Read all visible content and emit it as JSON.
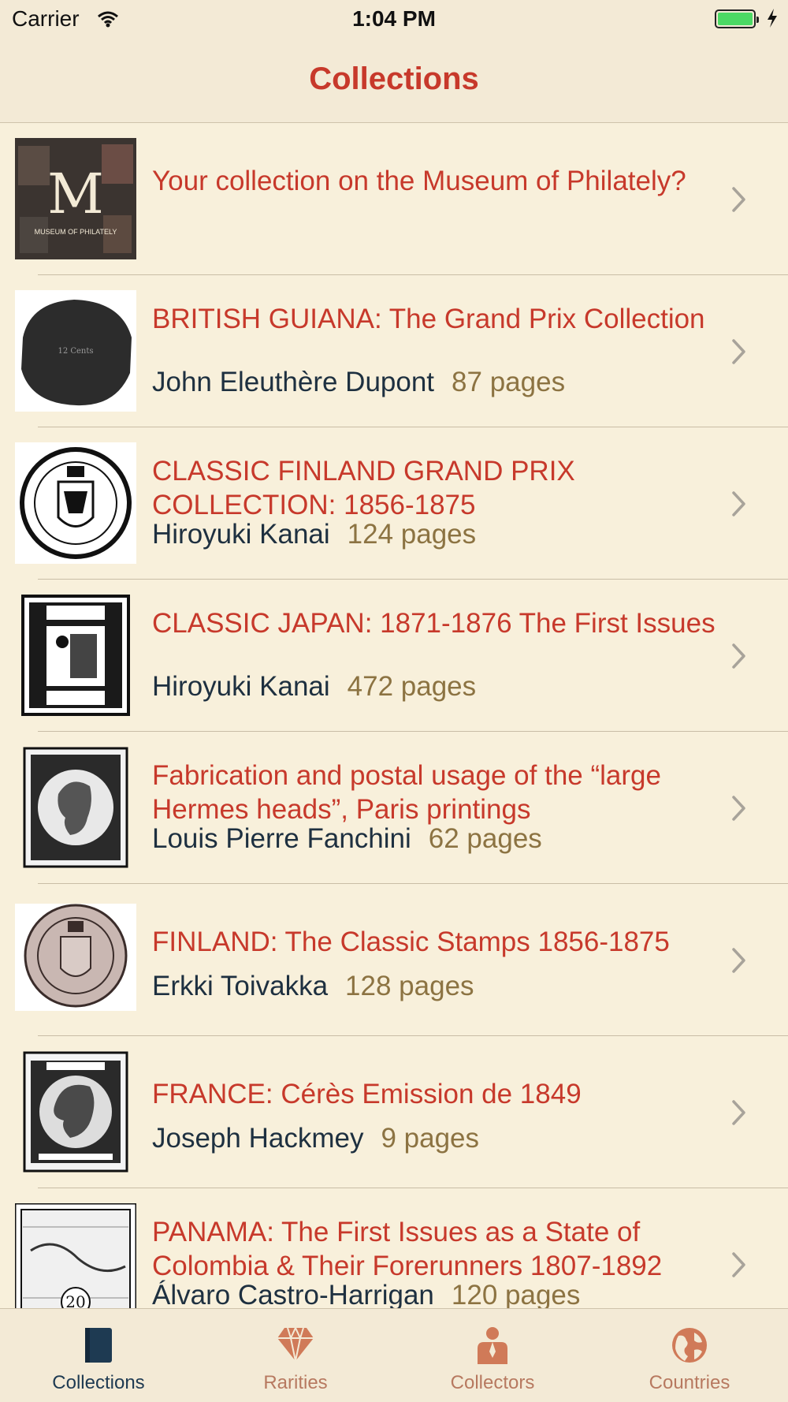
{
  "status_bar": {
    "carrier": "Carrier",
    "time": "1:04 PM",
    "battery_color": "#4cd964"
  },
  "nav": {
    "title": "Collections"
  },
  "promo": {
    "title": "Your collection on the Museum of Philately?",
    "logo_letters": "M",
    "logo_caption": "MUSEUM OF PHILATELY"
  },
  "collections": [
    {
      "title": "BRITISH GUIANA: The Grand Prix Collection",
      "collector": "John Eleuthère Dupont",
      "pages": "87 pages",
      "icon": "british-guiana-stamp-icon"
    },
    {
      "title": "CLASSIC FINLAND GRAND PRIX COLLECTION: 1856-1875",
      "collector": "Hiroyuki Kanai",
      "pages": "124 pages",
      "icon": "finland-stamp-icon"
    },
    {
      "title": "CLASSIC JAPAN: 1871-1876 The First Issues",
      "collector": "Hiroyuki Kanai",
      "pages": "472 pages",
      "icon": "japan-stamp-icon"
    },
    {
      "title": "Fabrication and postal usage of the “large Hermes heads”, Paris printings",
      "collector": "Louis Pierre Fanchini",
      "pages": "62 pages",
      "icon": "hermes-head-stamp-icon"
    },
    {
      "title": "FINLAND: The Classic Stamps 1856-1875",
      "collector": "Erkki Toivakka",
      "pages": "128 pages",
      "icon": "finland-classic-stamp-icon"
    },
    {
      "title": "FRANCE: Cérès Emission de 1849",
      "collector": "Joseph Hackmey",
      "pages": "9 pages",
      "icon": "ceres-stamp-icon"
    },
    {
      "title": "PANAMA: The First Issues as a State of Colombia & Their Forerunners 1807-1892",
      "collector": "Álvaro Castro-Harrigan",
      "pages": "120 pages",
      "icon": "panama-stamp-icon"
    }
  ],
  "tabs": [
    {
      "label": "Collections",
      "icon": "book-icon",
      "active": true
    },
    {
      "label": "Rarities",
      "icon": "diamond-icon",
      "active": false
    },
    {
      "label": "Collectors",
      "icon": "person-icon",
      "active": false
    },
    {
      "label": "Countries",
      "icon": "globe-icon",
      "active": false
    }
  ],
  "colors": {
    "accent": "#c7392b",
    "background": "#f8f0db",
    "bar": "#f3ead6",
    "collector_text": "#1e3040",
    "pages_text": "#8c7342",
    "tab_active": "#1e3a52",
    "tab_inactive": "#d07a58"
  }
}
